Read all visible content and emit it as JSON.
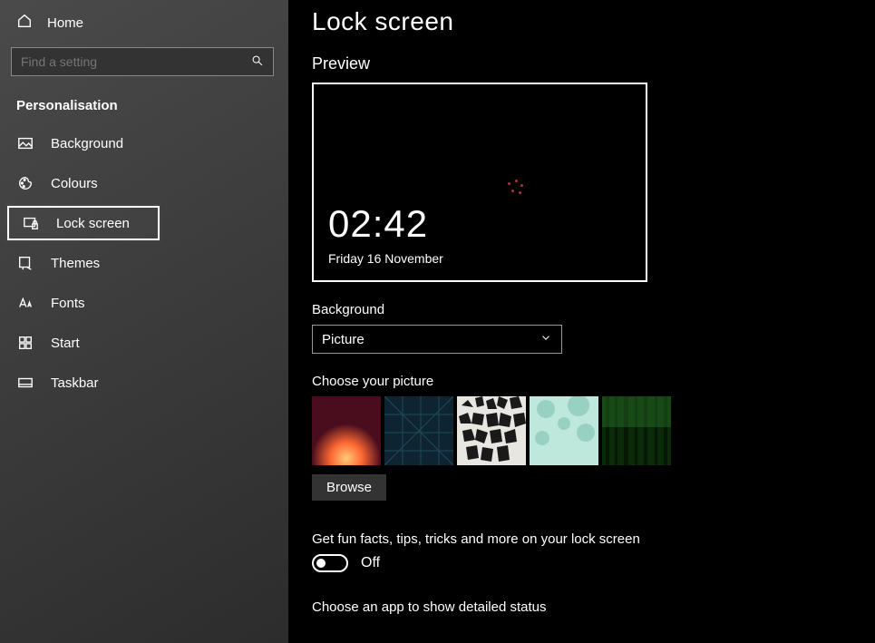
{
  "sidebar": {
    "home": "Home",
    "search_placeholder": "Find a setting",
    "category": "Personalisation",
    "items": [
      {
        "label": "Background"
      },
      {
        "label": "Colours"
      },
      {
        "label": "Lock screen"
      },
      {
        "label": "Themes"
      },
      {
        "label": "Fonts"
      },
      {
        "label": "Start"
      },
      {
        "label": "Taskbar"
      }
    ]
  },
  "main": {
    "title": "Lock screen",
    "preview_label": "Preview",
    "preview_time": "02:42",
    "preview_date": "Friday 16 November",
    "background_label": "Background",
    "background_value": "Picture",
    "choose_picture_label": "Choose your picture",
    "browse_label": "Browse",
    "fun_facts_label": "Get fun facts, tips, tricks and more on your lock screen",
    "fun_facts_state": "Off",
    "detailed_status_label": "Choose an app to show detailed status"
  }
}
